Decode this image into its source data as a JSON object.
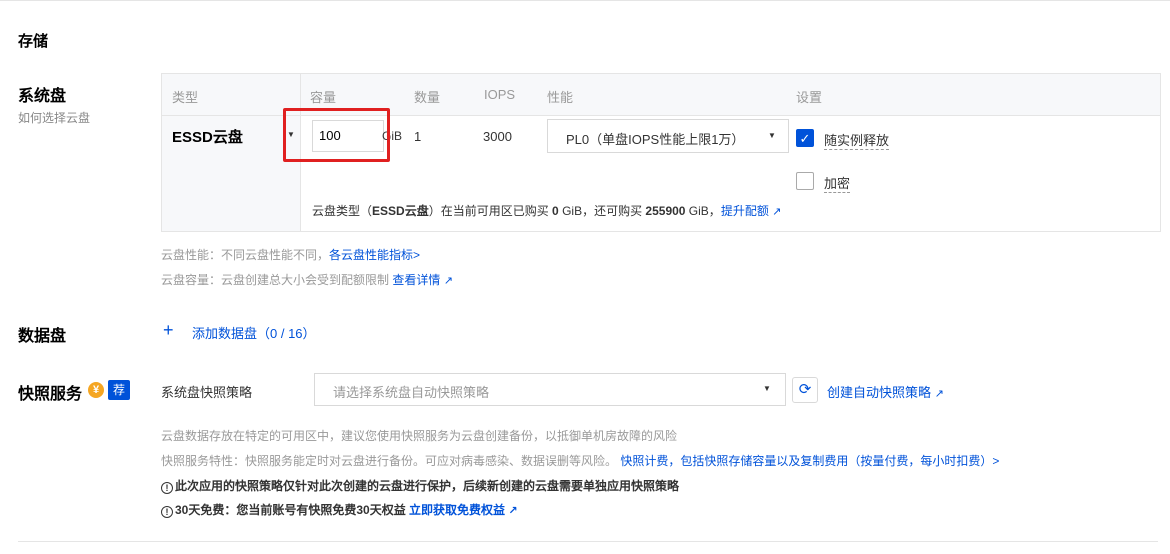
{
  "storage": {
    "section_title": "存储",
    "system_disk": {
      "label": "系统盘",
      "help_link": "如何选择云盘",
      "columns": [
        "类型",
        "容量",
        "数量",
        "IOPS",
        "性能",
        "设置"
      ],
      "type_value": "ESSD云盘",
      "capacity_value": "100",
      "capacity_unit": "GiB",
      "quantity": "1",
      "iops": "3000",
      "performance": "PL0（单盘IOPS性能上限1万）",
      "release_with_instance": {
        "label": "随实例释放",
        "checked": true
      },
      "encrypt": {
        "label": "加密",
        "checked": false
      },
      "quota_note": {
        "prefix": "云盘类型（",
        "type": "ESSD云盘",
        "middle1": "）在当前可用区已购买 ",
        "bought": "0",
        "middle2": " GiB，还可购买 ",
        "remaining": "255900",
        "middle3": " GiB，",
        "link": "提升配额"
      },
      "perf_note": {
        "text": "云盘性能：不同云盘性能不同，",
        "link": "各云盘性能指标>"
      },
      "capacity_note": {
        "text": "云盘容量：云盘创建总大小会受到配额限制 ",
        "link": "查看详情"
      }
    },
    "data_disk": {
      "label": "数据盘",
      "add_link": "添加数据盘（0 / 16）"
    },
    "snapshot": {
      "label": "快照服务",
      "coin_icon": "¥",
      "badge": "荐",
      "policy_label": "系统盘快照策略",
      "policy_placeholder": "请选择系统盘自动快照策略",
      "create_link": "创建自动快照策略",
      "note1": "云盘数据存放在特定的可用区中，建议您使用快照服务为云盘创建备份，以抵御单机房故障的风险",
      "note2_text": "快照服务特性：快照服务能定时对云盘进行备份。可应对病毒感染、数据误删等风险。",
      "note2_link": "快照计费，包括快照存储容量以及复制费用（按量付费，每小时扣费）>",
      "warning": "此次应用的快照策略仅针对此次创建的云盘进行保护，后续新创建的云盘需要单独应用快照策略",
      "free_text": "30天免费：您当前账号有快照免费30天权益 ",
      "free_link": "立即获取免费权益"
    }
  },
  "colors": {
    "accent": "#0052d9",
    "highlight": "#e02020"
  }
}
